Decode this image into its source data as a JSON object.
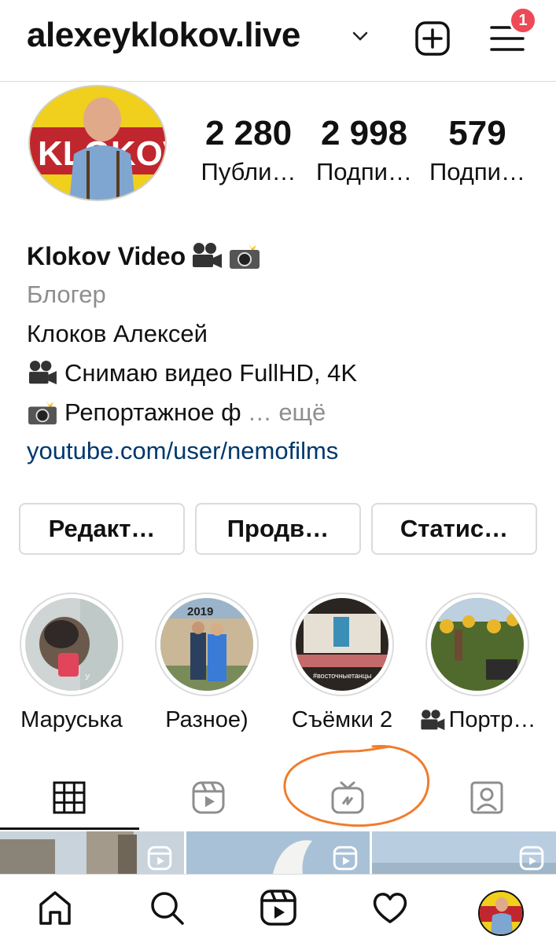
{
  "header": {
    "username": "alexeyklokov.live",
    "add_icon": "plus-square-icon",
    "menu_icon": "hamburger-menu-icon",
    "notification_count": "1"
  },
  "profile": {
    "stats": [
      {
        "value": "2 280",
        "label": "Публи…"
      },
      {
        "value": "2 998",
        "label": "Подпи…"
      },
      {
        "value": "579",
        "label": "Подпи…"
      }
    ],
    "avatar_text": "KLOKOV",
    "name": "Klokov Video",
    "name_emoji": [
      "movie-camera-icon",
      "camera-flash-icon"
    ],
    "category": "Блогер",
    "bio_lines": [
      "Клоков Алексей",
      "Снимаю видео FullHD, 4K",
      "Репортажное ф"
    ],
    "more_label": "… ещё",
    "link": "youtube.com/user/nemofilms"
  },
  "buttons": [
    "Редакт…",
    "Продв…",
    "Статис…"
  ],
  "highlights": [
    {
      "label": "Маруська",
      "overlay": "У"
    },
    {
      "label": "Разное)",
      "overlay": "2019"
    },
    {
      "label": "Съёмки 2",
      "overlay": "#восточныетанцы"
    },
    {
      "label": "Портр…",
      "overlay": ""
    }
  ],
  "tabs": [
    "grid-icon",
    "reels-icon",
    "igtv-icon",
    "tagged-icon"
  ],
  "active_tab": 0,
  "bottom_nav": [
    "home-icon",
    "search-icon",
    "reels-icon",
    "heart-icon",
    "profile-avatar"
  ],
  "colors": {
    "badge": "#ed4956",
    "link": "#00376b",
    "muted": "#8e8e8e",
    "annotation": "#ef7d2e",
    "avatar_yellow": "#f0cf1d",
    "avatar_red": "#c0262d"
  }
}
